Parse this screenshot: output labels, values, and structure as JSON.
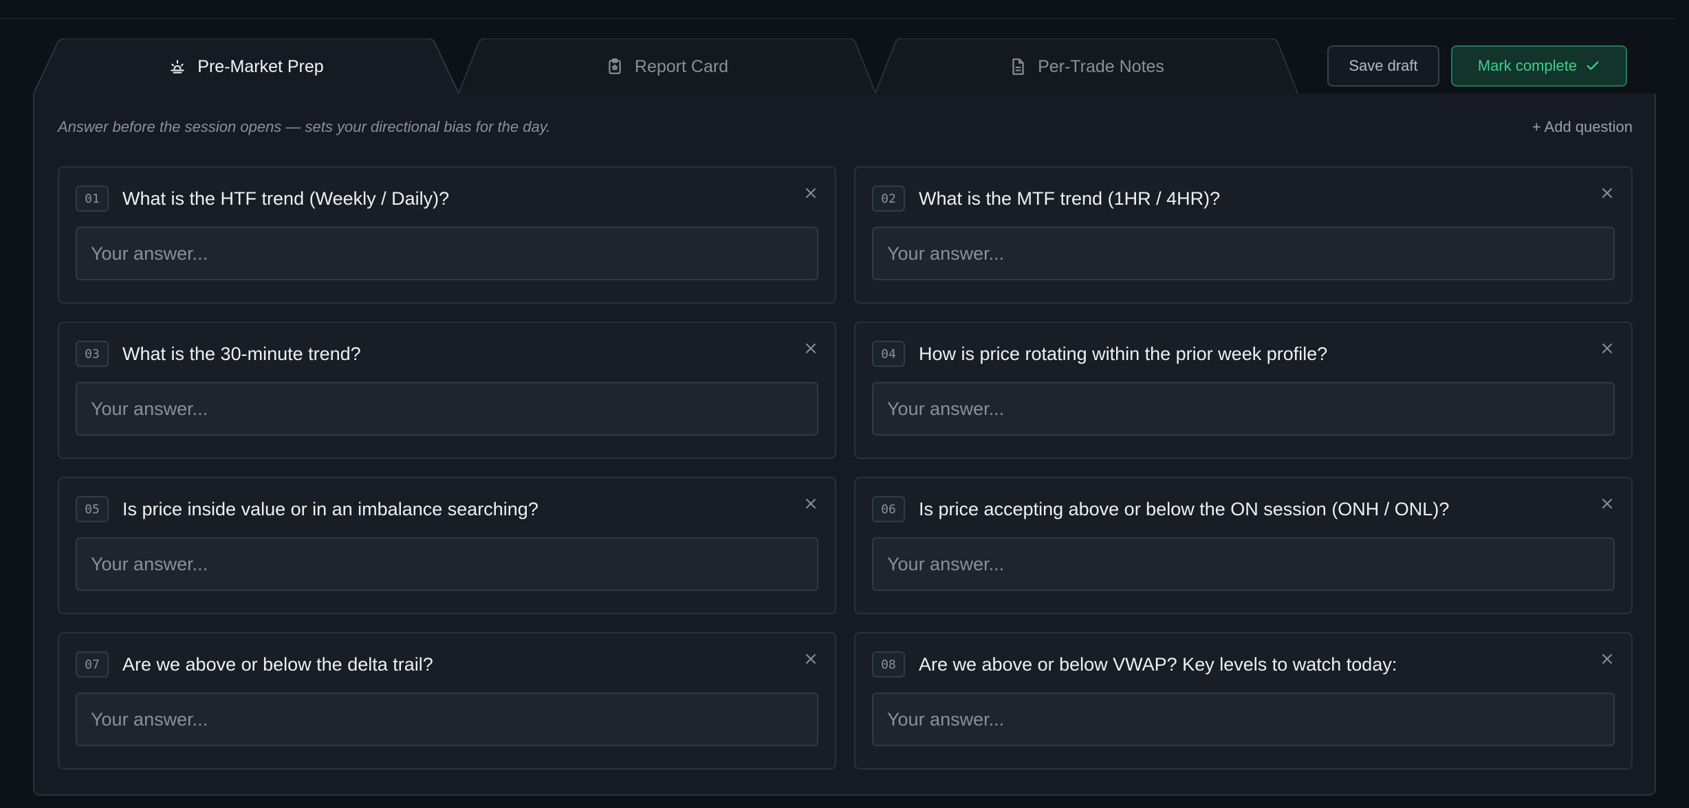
{
  "tabs": [
    {
      "label": "Pre-Market Prep",
      "icon": "sunrise-icon",
      "active": true
    },
    {
      "label": "Report Card",
      "icon": "clipboard-icon",
      "active": false
    },
    {
      "label": "Per-Trade Notes",
      "icon": "document-icon",
      "active": false
    }
  ],
  "actions": {
    "save_label": "Save draft",
    "complete_label": "Mark complete"
  },
  "panel": {
    "subtitle": "Answer before the session opens — sets your directional bias for the day.",
    "add_question_label": "+ Add question"
  },
  "questions": [
    {
      "num": "01",
      "text": "What is the HTF trend (Weekly / Daily)?",
      "placeholder": "Your answer..."
    },
    {
      "num": "02",
      "text": "What is the MTF trend (1HR / 4HR)?",
      "placeholder": "Your answer..."
    },
    {
      "num": "03",
      "text": "What is the 30-minute trend?",
      "placeholder": "Your answer..."
    },
    {
      "num": "04",
      "text": "How is price rotating within the prior week profile?",
      "placeholder": "Your answer..."
    },
    {
      "num": "05",
      "text": "Is price inside value or in an imbalance searching?",
      "placeholder": "Your answer..."
    },
    {
      "num": "06",
      "text": "Is price accepting above or below the ON session (ONH / ONL)?",
      "placeholder": "Your answer..."
    },
    {
      "num": "07",
      "text": "Are we above or below the delta trail?",
      "placeholder": "Your answer..."
    },
    {
      "num": "08",
      "text": "Are we above or below VWAP? Key levels to watch today:",
      "placeholder": "Your answer..."
    }
  ],
  "colors": {
    "background": "#0d1118",
    "panel": "#161b23",
    "accent_green": "#3ecf8e"
  }
}
